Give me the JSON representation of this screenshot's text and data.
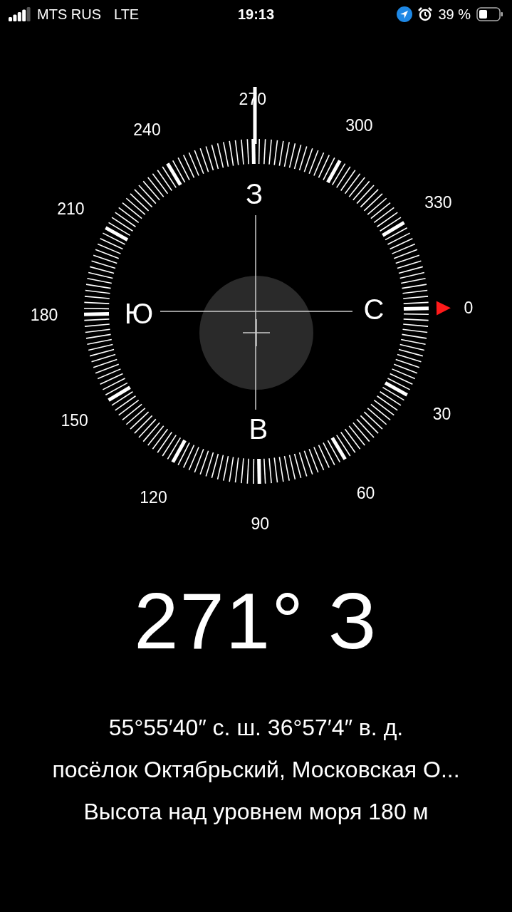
{
  "status_bar": {
    "carrier": "MTS RUS",
    "network": "LTE",
    "time": "19:13",
    "battery": "39 %"
  },
  "compass": {
    "degree_labels": [
      "0",
      "30",
      "60",
      "90",
      "120",
      "150",
      "180",
      "210",
      "240",
      "270",
      "300",
      "330"
    ],
    "directions": [
      "С",
      "В",
      "Ю",
      "З"
    ]
  },
  "heading": "271° З",
  "coordinates": "55°55′40″ с. ш.  36°57′4″ в. д.",
  "place": "посёлок Октябрьский, Московская О...",
  "altitude": "Высота над уровнем моря 180 м"
}
